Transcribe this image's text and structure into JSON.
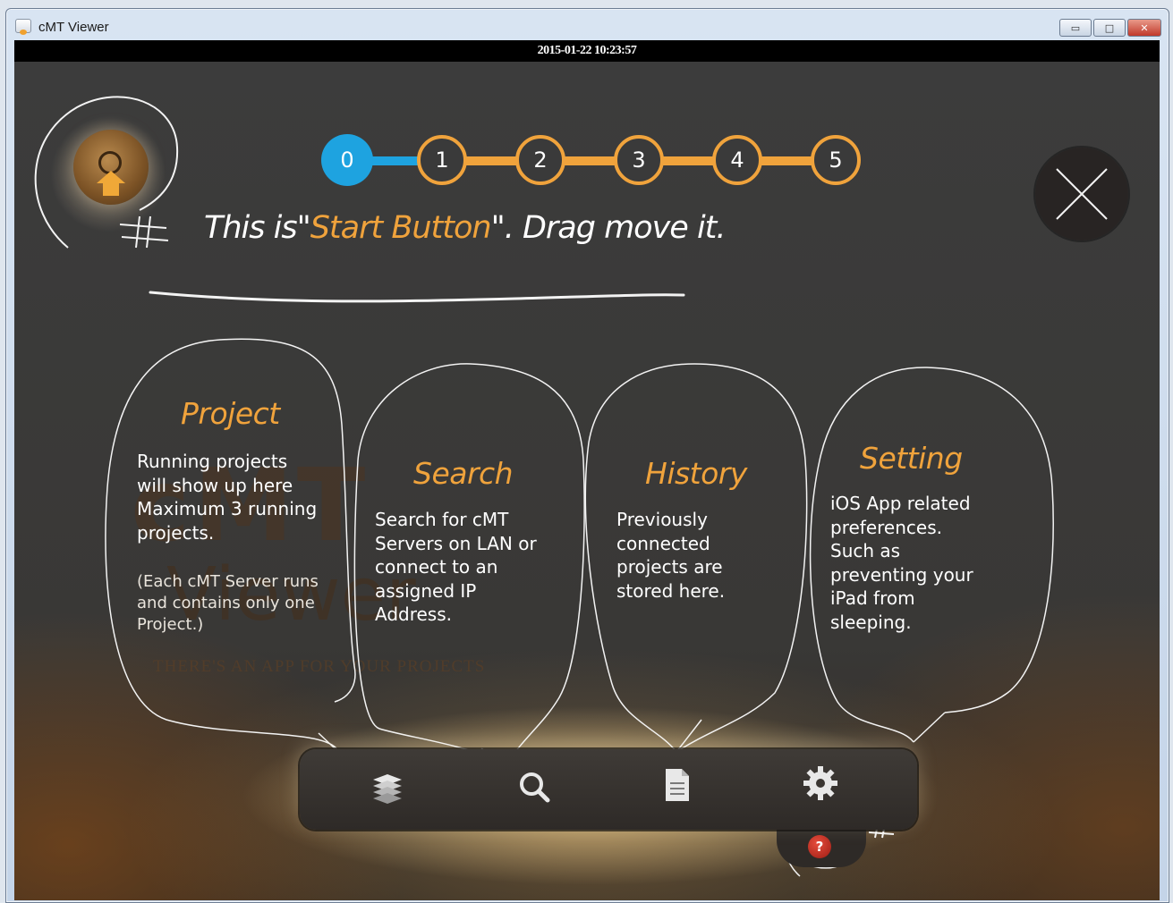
{
  "window": {
    "title": "cMT Viewer",
    "minimize_label": "▭",
    "maximize_label": "□",
    "close_label": "✕"
  },
  "status_bar": {
    "datetime": "2015-01-22 10:23:57"
  },
  "steps": {
    "items": [
      "0",
      "1",
      "2",
      "3",
      "4",
      "5"
    ],
    "active_index": 0,
    "colors": {
      "active": "#1ea3e0",
      "inactive_border": "#f0a33c"
    }
  },
  "instruction": {
    "prefix": "This is\"",
    "highlight": "Start Button",
    "suffix": "\". Drag move it."
  },
  "watermark": {
    "logo_top": "cMT",
    "logo_bottom": "Viewer",
    "tagline": "THERE'S AN APP FOR YOUR PROJECTS"
  },
  "bubbles": {
    "project": {
      "title": "Project",
      "text": "Running projects\nwill show up here\nMaximum 3 running\nprojects.",
      "note": "(Each cMT Server runs\nand contains only one\nProject.)"
    },
    "search": {
      "title": "Search",
      "text": "Search for cMT\nServers on LAN or\nconnect to an\nassigned IP\nAddress."
    },
    "history": {
      "title": "History",
      "text": "Previously\nconnected\nprojects are\nstored here."
    },
    "setting": {
      "title": "Setting",
      "text": "iOS App related\npreferences.\nSuch as\npreventing your\niPad from\nsleeping."
    }
  },
  "dock": {
    "icons": [
      "projects-stack-icon",
      "search-icon",
      "history-document-icon",
      "settings-gear-icon"
    ],
    "help_label": "?"
  },
  "colors": {
    "accent_orange": "#f0a33c",
    "accent_blue": "#1ea3e0",
    "help_red": "#c0392b"
  }
}
